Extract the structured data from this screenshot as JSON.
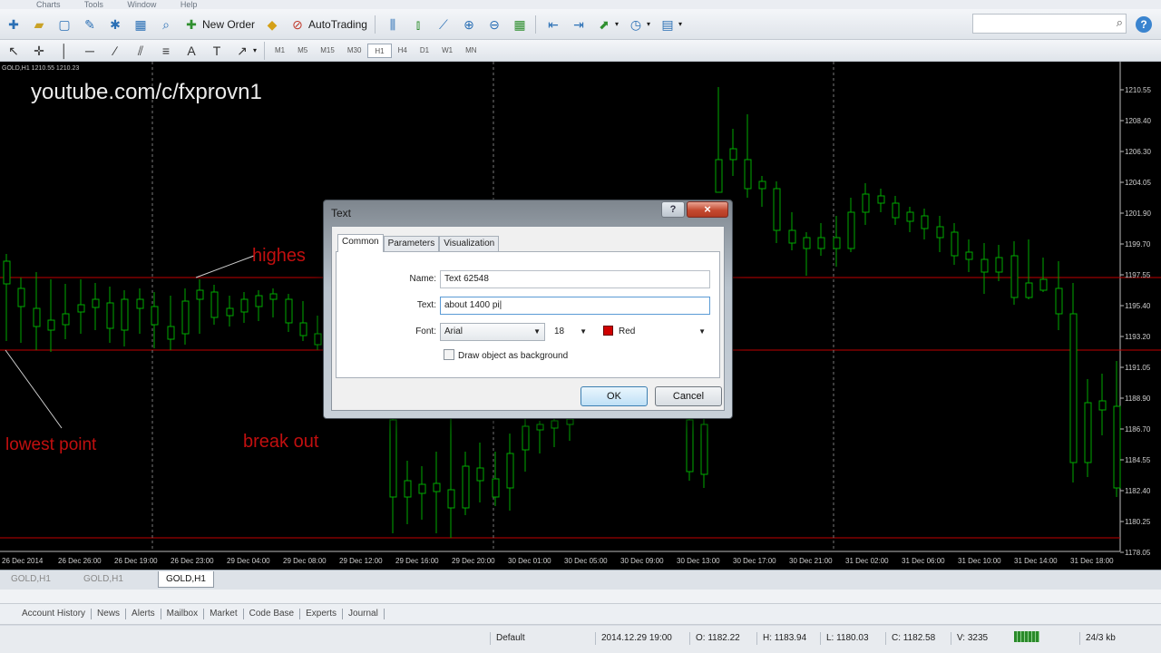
{
  "menubar": {
    "items": [
      "Charts",
      "Tools",
      "Window",
      "Help"
    ]
  },
  "toolbar": {
    "new_order_label": "New Order",
    "autotrading_label": "AutoTrading",
    "timeframes": [
      "M1",
      "M5",
      "M15",
      "M30",
      "H1",
      "H4",
      "D1",
      "W1",
      "MN"
    ],
    "active_timeframe": "H1"
  },
  "search": {
    "placeholder": ""
  },
  "chart": {
    "info": "GOLD,H1  1210.55 1210.23",
    "channel_text": "youtube.com/c/fxprovn1",
    "annotations": [
      "highes",
      "lowest point",
      "break out"
    ],
    "price_labels": [
      "1210.55",
      "1208.40",
      "1206.30",
      "1204.05",
      "1201.90",
      "1199.70",
      "1197.55",
      "1195.40",
      "1193.20",
      "1191.05",
      "1188.90",
      "1186.70",
      "1184.55",
      "1182.40",
      "1180.25",
      "1178.05"
    ],
    "time_labels": [
      "26 Dec 2014",
      "26 Dec 26:00",
      "26 Dec 19:00",
      "26 Dec 23:00",
      "29 Dec 04:00",
      "29 Dec 08:00",
      "29 Dec 12:00",
      "29 Dec 16:00",
      "29 Dec 20:00",
      "30 Dec 01:00",
      "30 Dec 05:00",
      "30 Dec 09:00",
      "30 Dec 13:00",
      "30 Dec 17:00",
      "30 Dec 21:00",
      "31 Dec 02:00",
      "31 Dec 06:00",
      "31 Dec 10:00",
      "31 Dec 14:00",
      "31 Dec 18:00"
    ],
    "colors": {
      "background": "#000000",
      "bull": "#ffffff",
      "bear": "#00aa00",
      "level": "#c00000"
    }
  },
  "dialog": {
    "title": "Text",
    "help": "?",
    "close": "×",
    "tabs": [
      "Common",
      "Parameters",
      "Visualization"
    ],
    "name_label": "Name:",
    "name_value": "Text 62548",
    "text_label": "Text:",
    "text_value": "about 1400 pi",
    "font_label": "Font:",
    "font_value": "Arial",
    "size_value": "18",
    "color_value": "Red",
    "checkbox_label": "Draw object as background",
    "ok": "OK",
    "cancel": "Cancel"
  },
  "chart_tabs": [
    "GOLD,H1",
    "GOLD,H1",
    "GOLD,H1"
  ],
  "terminal_tabs": [
    "Account History",
    "News",
    "Alerts",
    "Mailbox",
    "Market",
    "Code Base",
    "Experts",
    "Journal"
  ],
  "status": {
    "profile": "Default",
    "datetime": "2014.12.29 19:00",
    "open": "O: 1182.22",
    "high": "H: 1183.94",
    "low": "L: 1180.03",
    "close": "C: 1182.58",
    "volume": "V: 3235",
    "traffic": "24/3 kb"
  }
}
